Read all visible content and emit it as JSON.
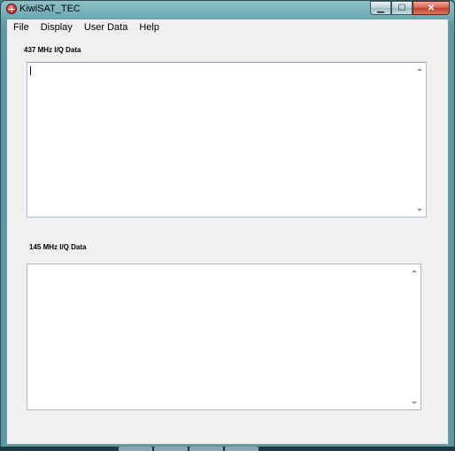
{
  "window": {
    "title": "KiwiSAT_TEC",
    "controls": {
      "minimize_icon": "minimize-icon",
      "maximize_icon": "maximize-icon",
      "close_icon": "close-icon"
    }
  },
  "menu": {
    "items": [
      {
        "label": "File"
      },
      {
        "label": "Display"
      },
      {
        "label": "User Data"
      },
      {
        "label": "Help"
      }
    ]
  },
  "panels": {
    "iq437": {
      "label": "437 MHz I/Q Data",
      "value": ""
    },
    "iq145": {
      "label": "145 MHz I/Q Data",
      "value": ""
    }
  }
}
